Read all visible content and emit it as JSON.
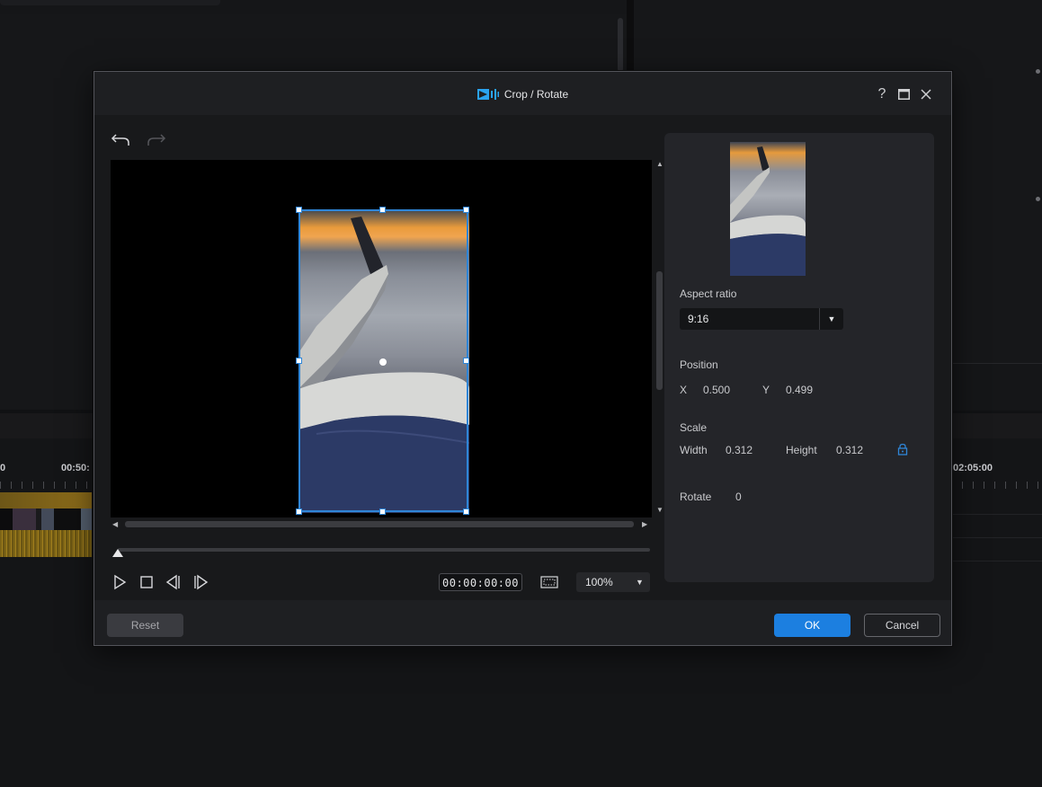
{
  "background": {
    "ruler_left": "0",
    "ruler_mid": "00:50:",
    "ruler_right": "02:05:00"
  },
  "dialog": {
    "title": "Crop / Rotate",
    "help_icon": "?",
    "maximize_icon": "maximize-icon",
    "close_icon": "close-icon"
  },
  "toolbar": {
    "undo_icon": "undo-icon",
    "redo_icon": "redo-icon"
  },
  "playback": {
    "timecode": "00:00:00:00",
    "zoom": "100%",
    "seek_position": 0
  },
  "settings": {
    "aspect_ratio_label": "Aspect ratio",
    "aspect_ratio_value": "9:16",
    "position_label": "Position",
    "x_label": "X",
    "x_value": "0.500",
    "y_label": "Y",
    "y_value": "0.499",
    "scale_label": "Scale",
    "width_label": "Width",
    "width_value": "0.312",
    "height_label": "Height",
    "height_value": "0.312",
    "rotate_label": "Rotate",
    "rotate_value": "0"
  },
  "footer": {
    "reset_label": "Reset",
    "ok_label": "OK",
    "cancel_label": "Cancel"
  },
  "colors": {
    "accent": "#1c7fe0",
    "crop_frame": "#2f86d8",
    "dialog_bg": "#1e1f22"
  }
}
